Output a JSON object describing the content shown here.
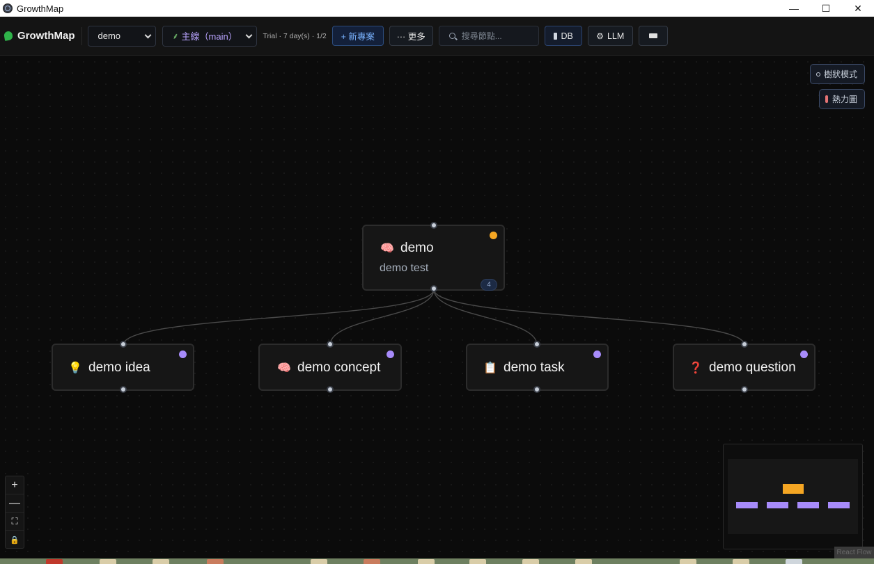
{
  "window": {
    "title": "GrowthMap",
    "controls": {
      "minimize": "—",
      "maximize": "☐",
      "close": "✕"
    }
  },
  "toolbar": {
    "brand": "GrowthMap",
    "project_select": "demo",
    "branch_select": "主線（main）",
    "trial": "Trial · 7 day(s) · 1/2",
    "new_project": "+ 新專案",
    "more": "··· 更多",
    "search_placeholder": "搜尋節點...",
    "db": "DB",
    "llm": "LLM"
  },
  "side_buttons": {
    "tree_mode": "樹狀模式",
    "heatmap": "熱力圖"
  },
  "nodes": {
    "root": {
      "emoji": "🧠",
      "title": "demo",
      "subtitle": "demo test",
      "count": "4",
      "dot_color": "#f5a623"
    },
    "idea": {
      "emoji": "💡",
      "title": "demo idea",
      "dot_color": "#a78bfa"
    },
    "concept": {
      "emoji": "🧠",
      "title": "demo concept",
      "dot_color": "#a78bfa"
    },
    "task": {
      "emoji": "📋",
      "title": "demo task",
      "dot_color": "#a78bfa"
    },
    "question": {
      "emoji": "❓",
      "title": "demo question",
      "dot_color": "#a78bfa"
    }
  },
  "zoom_controls": {
    "zoom_in": "+",
    "zoom_out": "—",
    "fit": "⛶",
    "lock": "🔒"
  },
  "minimap": {
    "root_color": "#f5a623",
    "child_color": "#a78bfa"
  },
  "watermark": "React Flow",
  "colors": {
    "accent": "#7ab3ff",
    "branch": "#b9a4ff",
    "brand_leaf": "#2fb34a"
  }
}
